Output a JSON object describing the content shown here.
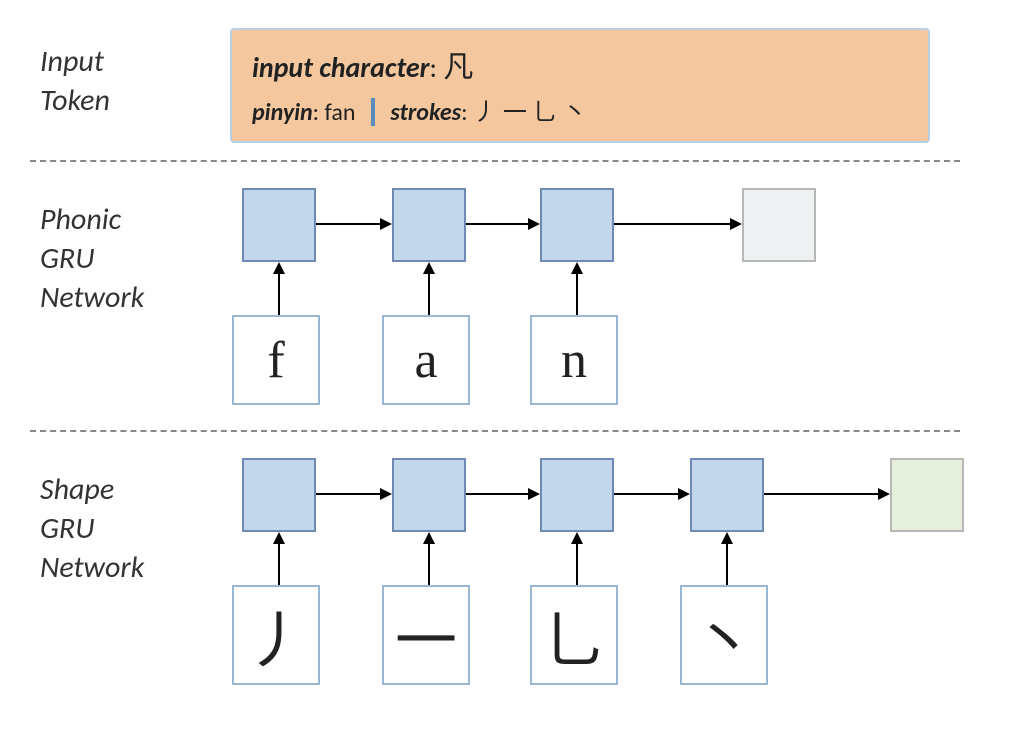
{
  "labels": {
    "input_token_l1": "Input",
    "input_token_l2": "Token",
    "phonic_l1": "Phonic",
    "phonic_l2": "GRU",
    "phonic_l3": "Network",
    "shape_l1": "Shape",
    "shape_l2": "GRU",
    "shape_l3": "Network"
  },
  "input_card": {
    "char_label": "input character",
    "char_value": "凡",
    "pinyin_label": "pinyin",
    "pinyin_value": "fan",
    "strokes_label": "strokes",
    "strokes_value": "丿 一 乚 丶"
  },
  "phonic_tokens": [
    "f",
    "a",
    "n"
  ],
  "shape_tokens": [
    "丿",
    "一",
    "乚",
    "丶"
  ]
}
